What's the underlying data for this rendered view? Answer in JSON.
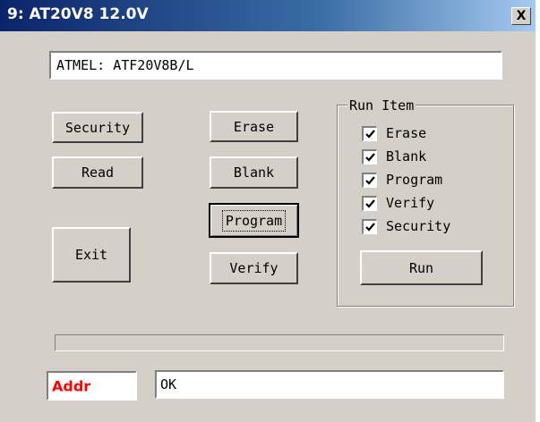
{
  "window": {
    "title": "9: AT20V8 12.0V",
    "close_label": "X"
  },
  "device_field": {
    "value": "ATMEL: ATF20V8B/L"
  },
  "buttons": {
    "security": "Security",
    "read": "Read",
    "exit": "Exit",
    "erase": "Erase",
    "blank": "Blank",
    "program": "Program",
    "verify": "Verify",
    "run": "Run"
  },
  "run_item": {
    "legend": "Run Item",
    "items": [
      {
        "label": "Erase",
        "checked": true
      },
      {
        "label": "Blank",
        "checked": true
      },
      {
        "label": "Program",
        "checked": true
      },
      {
        "label": "Verify",
        "checked": true
      },
      {
        "label": "Security",
        "checked": true
      }
    ]
  },
  "progress": {
    "value": 0
  },
  "status": {
    "addr_label": "Addr",
    "message": "OK"
  },
  "colors": {
    "title_bar": "#0a246a",
    "addr_text": "#ff0000",
    "face": "#d4d0c8"
  }
}
